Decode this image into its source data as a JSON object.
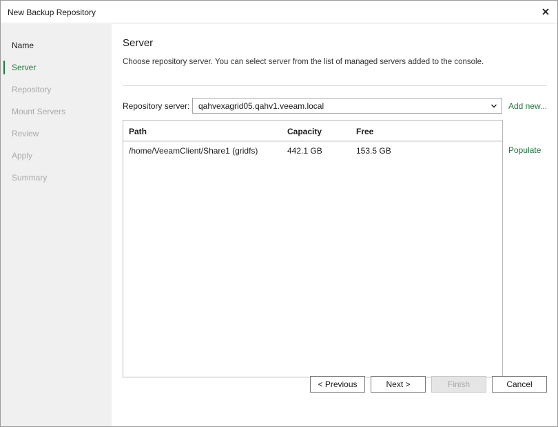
{
  "window": {
    "title": "New Backup Repository"
  },
  "sidebar": {
    "steps": [
      {
        "label": "Name"
      },
      {
        "label": "Server"
      },
      {
        "label": "Repository"
      },
      {
        "label": "Mount Servers"
      },
      {
        "label": "Review"
      },
      {
        "label": "Apply"
      },
      {
        "label": "Summary"
      }
    ]
  },
  "main": {
    "title": "Server",
    "description": "Choose repository server. You can select server from the list of managed servers added to the console.",
    "repository_server_label": "Repository server:",
    "repository_server_value": "qahvexagrid05.qahv1.veeam.local",
    "add_new_label": "Add new...",
    "populate_label": "Populate",
    "table": {
      "columns": [
        "Path",
        "Capacity",
        "Free"
      ],
      "rows": [
        [
          "/home/VeeamClient/Share1 (gridfs)",
          "442.1 GB",
          "153.5 GB"
        ]
      ]
    }
  },
  "buttons": {
    "previous": "< Previous",
    "next": "Next >",
    "finish": "Finish",
    "cancel": "Cancel"
  },
  "colors": {
    "accent": "#1d7a3a",
    "sidebar_bg": "#f0f0f0",
    "disabled_text": "#a9a9a9"
  },
  "icons": {
    "close": "close-icon",
    "dropdown": "chevron-down-icon"
  }
}
